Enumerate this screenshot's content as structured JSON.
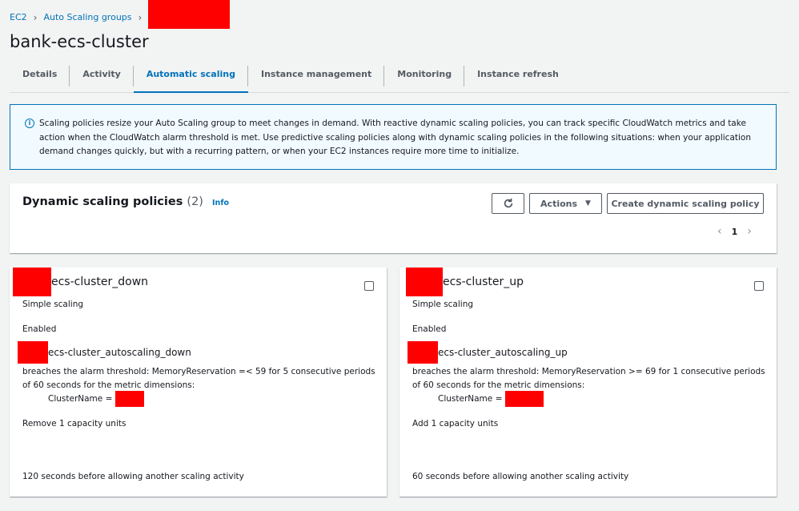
{
  "breadcrumb": {
    "items": [
      "EC2",
      "Auto Scaling groups"
    ]
  },
  "page": {
    "title": "bank-ecs-cluster"
  },
  "tabs": [
    {
      "label": "Details"
    },
    {
      "label": "Activity"
    },
    {
      "label": "Automatic scaling"
    },
    {
      "label": "Instance management"
    },
    {
      "label": "Monitoring"
    },
    {
      "label": "Instance refresh"
    }
  ],
  "info_box": {
    "text": "Scaling policies resize your Auto Scaling group to meet changes in demand. With reactive dynamic scaling policies, you can track specific CloudWatch metrics and take action when the CloudWatch alarm threshold is met. Use predictive scaling policies along with dynamic scaling policies in the following situations: when your application demand changes quickly, but with a recurring pattern, or when your EC2 instances require more time to initialize."
  },
  "policies": {
    "title": "Dynamic scaling policies",
    "count": "(2)",
    "info_link": "Info",
    "actions_label": "Actions",
    "create_label": "Create dynamic scaling policy",
    "current_page": "1",
    "cards": [
      {
        "name_suffix": "ecs-cluster_down",
        "type": "Simple scaling",
        "status": "Enabled",
        "alarm_suffix": "ecs-cluster_autoscaling_down",
        "breach": "breaches the alarm threshold: MemoryReservation =< 59 for 5 consecutive periods of 60 seconds for the metric dimensions:",
        "dimension": "ClusterName =",
        "action": "Remove 1 capacity units",
        "cooldown": "120 seconds before allowing another scaling activity"
      },
      {
        "name_suffix": "ecs-cluster_up",
        "type": "Simple scaling",
        "status": "Enabled",
        "alarm_suffix": "ecs-cluster_autoscaling_up",
        "breach": "breaches the alarm threshold: MemoryReservation >= 69 for 1 consecutive periods of 60 seconds for the metric dimensions:",
        "dimension": "ClusterName =",
        "action": "Add 1 capacity units",
        "cooldown": "60 seconds before allowing another scaling activity"
      }
    ]
  },
  "colors": {
    "accent": "#0073bb",
    "redaction": "#ff0000",
    "background": "#f2f3f3"
  }
}
